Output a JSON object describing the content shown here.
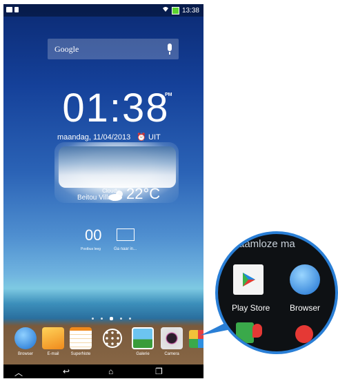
{
  "statusbar": {
    "time": "13:38"
  },
  "search": {
    "label": "Google"
  },
  "clock": {
    "time": "01:38",
    "ampm": "PM",
    "date": "maandag, 11/04/2013",
    "alarm": "UIT"
  },
  "weather": {
    "condition": "Cloudy",
    "location": "Beitou Village",
    "temperature": "22°C"
  },
  "messages": {
    "count": "00",
    "left_label": "Postbus leeg",
    "right_label": "Ga naar in..."
  },
  "dock": [
    {
      "label": "Browser",
      "icon": "globe-icon"
    },
    {
      "label": "E-mail",
      "icon": "email-icon"
    },
    {
      "label": "SuperNote",
      "icon": "notes-icon"
    },
    {
      "label": "",
      "icon": "all-apps-icon"
    },
    {
      "label": "Galerie",
      "icon": "gallery-icon"
    },
    {
      "label": "Camera",
      "icon": "camera-icon"
    },
    {
      "label": "",
      "icon": "folder-icon"
    }
  ],
  "zoom": {
    "folder_title": "aamloze ma",
    "items": [
      {
        "label": "Play Store",
        "icon": "play-store-icon"
      },
      {
        "label": "Browser",
        "icon": "globe-icon"
      }
    ]
  }
}
